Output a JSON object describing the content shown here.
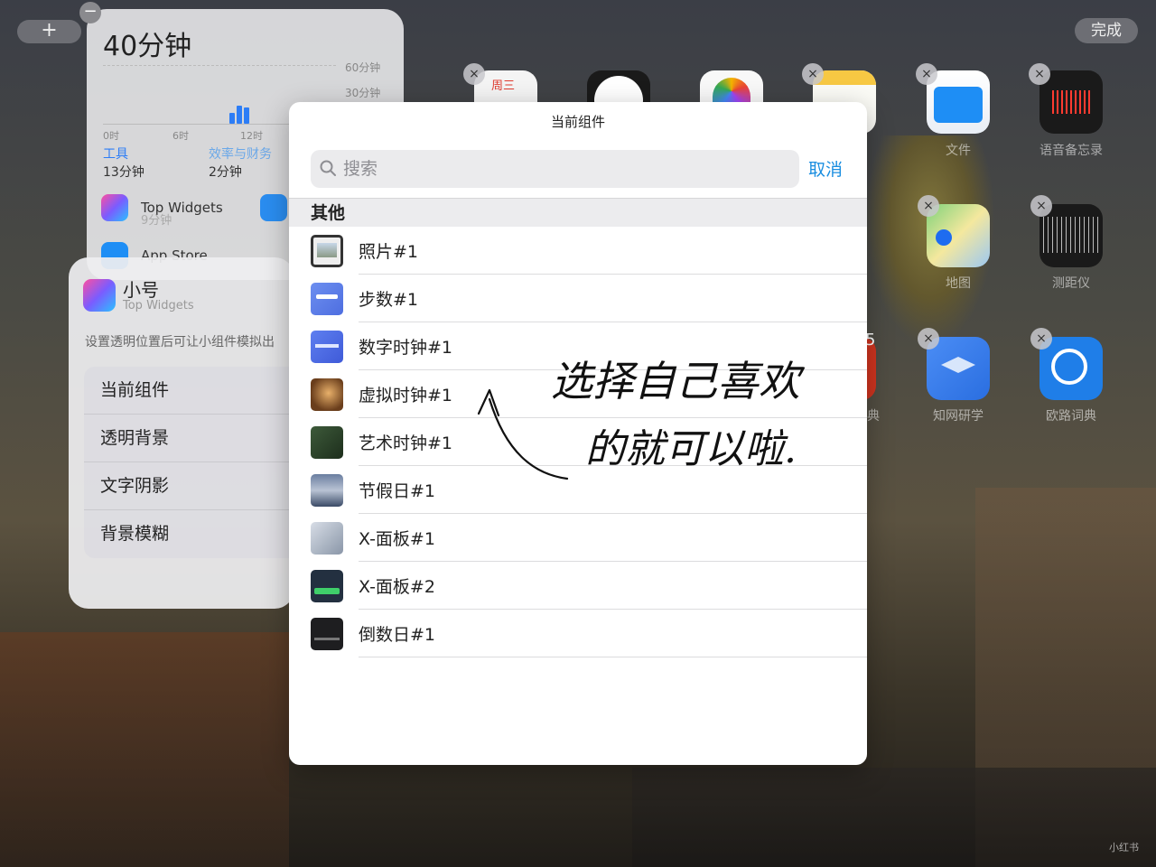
{
  "top_bar": {
    "add_label": "+",
    "done_label": "完成"
  },
  "screen_time": {
    "total": "40分钟",
    "y_labels": [
      "60分钟",
      "30分钟"
    ],
    "x_labels": [
      "0时",
      "6时",
      "12时"
    ],
    "categories": [
      {
        "name": "工具",
        "value": "13分钟"
      },
      {
        "name": "效率与财务",
        "value": "2分钟"
      }
    ],
    "apps": [
      {
        "name": "Top Widgets",
        "time": "9分钟"
      },
      {
        "name": "App Store"
      }
    ],
    "minus_label": "−"
  },
  "settings_card": {
    "title": "小号",
    "subtitle": "Top Widgets",
    "description": "设置透明位置后可让小组件模拟出",
    "items": [
      "当前组件",
      "透明背景",
      "文字阴影",
      "背景模糊"
    ]
  },
  "home_icons": {
    "calendar_day": "周三",
    "files": "文件",
    "voice_memos": "语音备忘录",
    "maps": "地图",
    "measure": "测距仪",
    "cnki": "知网研学",
    "eudic": "欧路词典",
    "dict_partial": "典",
    "badge_count": "5",
    "remove_label": "×"
  },
  "modal": {
    "title": "当前组件",
    "search": {
      "placeholder": "搜索"
    },
    "cancel_label": "取消",
    "section_header": "其他",
    "widgets": [
      {
        "name": "照片#1",
        "thumb": "photo"
      },
      {
        "name": "步数#1",
        "thumb": "steps"
      },
      {
        "name": "数字时钟#1",
        "thumb": "digital-clock"
      },
      {
        "name": "虚拟时钟#1",
        "thumb": "virtual-clock"
      },
      {
        "name": "艺术时钟#1",
        "thumb": "art-clock"
      },
      {
        "name": "节假日#1",
        "thumb": "holiday"
      },
      {
        "name": "X-面板#1",
        "thumb": "panel1"
      },
      {
        "name": "X-面板#2",
        "thumb": "panel2"
      },
      {
        "name": "倒数日#1",
        "thumb": "countdown"
      }
    ]
  },
  "annotation": {
    "line1": "选择自己喜欢",
    "line2": "的就可以啦."
  },
  "watermark": "小红书",
  "colors": {
    "accent": "#1a8ee0",
    "screen_time_blue": "#2d7df6"
  }
}
